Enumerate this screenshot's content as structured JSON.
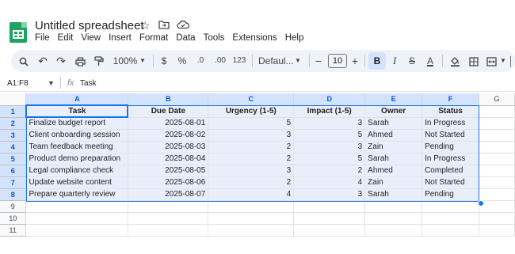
{
  "app": {
    "title": "Untitled spreadsheet",
    "menu": [
      "File",
      "Edit",
      "View",
      "Insert",
      "Format",
      "Data",
      "Tools",
      "Extensions",
      "Help"
    ]
  },
  "toolbar": {
    "zoom": "100%",
    "currency": "$",
    "percent": "%",
    "decrease_decimal": ".0",
    "increase_decimal": ".00",
    "number_format": "123",
    "font": "Defaul...",
    "font_size": "10",
    "bold": "B",
    "italic": "I",
    "strikethrough": "S",
    "text_color": "A",
    "minus": "−",
    "plus": "+"
  },
  "formula_bar": {
    "name_box": "A1:F8",
    "fx": "fx",
    "content": "Task"
  },
  "grid": {
    "columns": [
      "A",
      "B",
      "C",
      "D",
      "E",
      "F",
      "G"
    ],
    "row_numbers": [
      "1",
      "2",
      "3",
      "4",
      "5",
      "6",
      "7",
      "8",
      "9",
      "10",
      "11"
    ],
    "header": [
      "Task",
      "Due Date",
      "Urgency (1-5)",
      "Impact (1-5)",
      "Owner",
      "Status"
    ],
    "rows": [
      [
        "Finalize budget report",
        "2025-08-01",
        "5",
        "3",
        "Sarah",
        "In Progress"
      ],
      [
        "Client onboarding session",
        "2025-08-02",
        "3",
        "5",
        "Ahmed",
        "Not Started"
      ],
      [
        "Team feedback meeting",
        "2025-08-03",
        "2",
        "3",
        "Zain",
        "Pending"
      ],
      [
        "Product demo preparation",
        "2025-08-04",
        "2",
        "5",
        "Sarah",
        "In Progress"
      ],
      [
        "Legal compliance check",
        "2025-08-05",
        "3",
        "2",
        "Ahmed",
        "Completed"
      ],
      [
        "Update website content",
        "2025-08-06",
        "2",
        "4",
        "Zain",
        "Not Started"
      ],
      [
        "Prepare quarterly review",
        "2025-08-07",
        "4",
        "3",
        "Sarah",
        "Pending"
      ]
    ]
  },
  "colors": {
    "accent": "#1a73e8",
    "selection_fill": "#e8effb",
    "logo_green": "#1ea362"
  }
}
